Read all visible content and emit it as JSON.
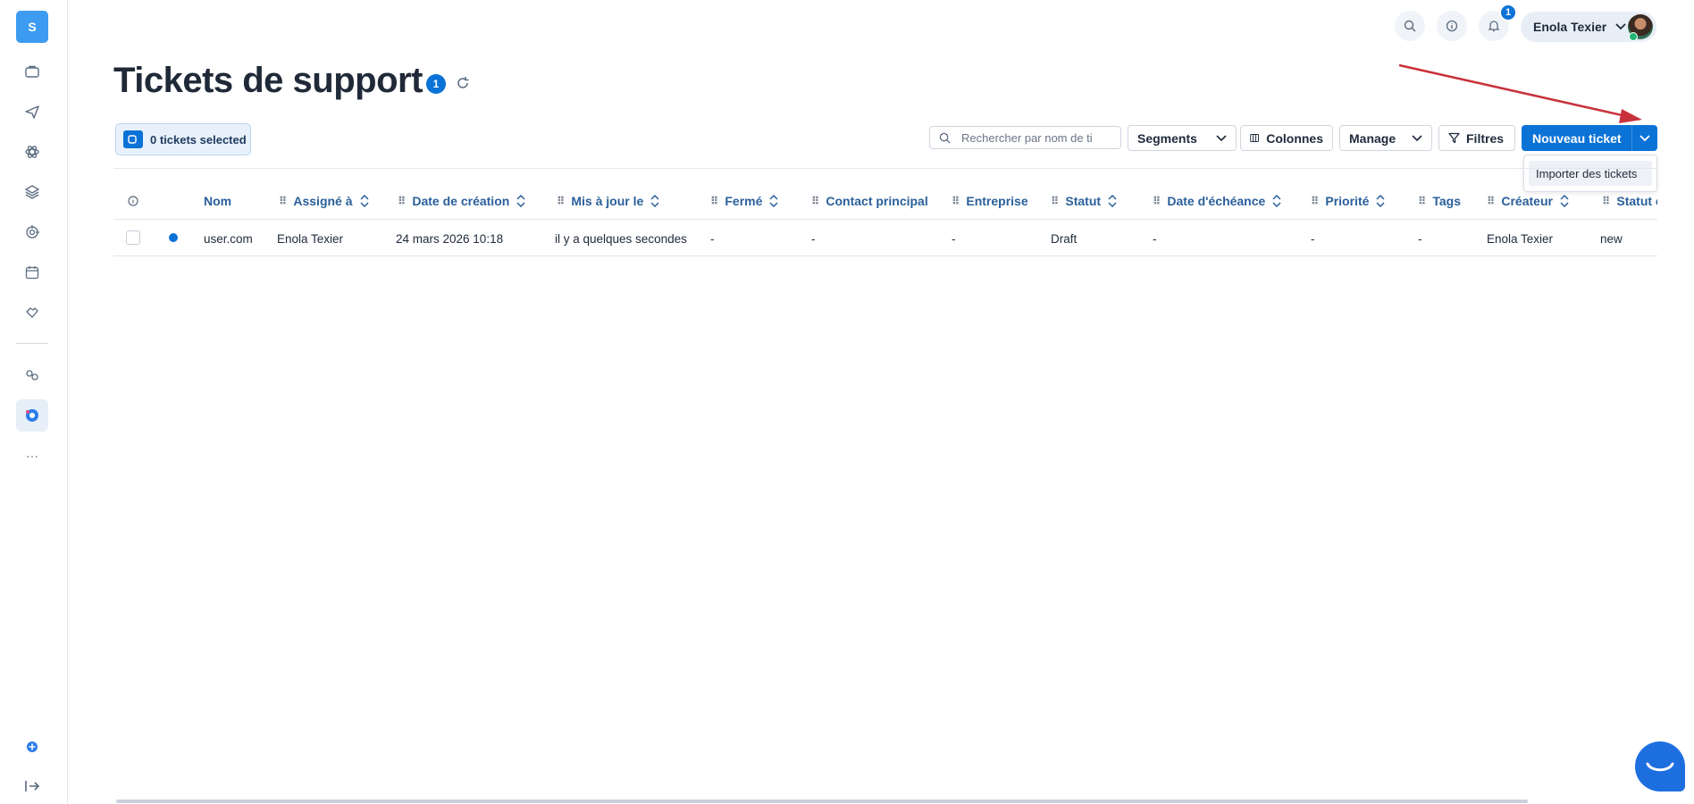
{
  "sidebar": {
    "logo_letter": "S",
    "items": [
      {
        "icon": "briefcase-icon"
      },
      {
        "icon": "paper-plane-icon"
      },
      {
        "icon": "atom-icon"
      },
      {
        "icon": "layers-icon"
      },
      {
        "icon": "target-icon"
      },
      {
        "icon": "calendar-icon"
      },
      {
        "icon": "handshake-icon"
      },
      {
        "icon": "partners-icon"
      },
      {
        "icon": "support-icon",
        "active": true
      },
      {
        "icon": "more-icon",
        "label": "···"
      }
    ],
    "bottom": [
      {
        "icon": "help-icon"
      },
      {
        "icon": "logout-icon"
      }
    ]
  },
  "topbar": {
    "notifications_count": "1",
    "user_name": "Enola Texier"
  },
  "page": {
    "title": "Tickets de support",
    "count": "1"
  },
  "selection": {
    "label": "0 tickets selected"
  },
  "toolbar": {
    "search_placeholder": "Rechercher par nom de ti",
    "segments_label": "Segments",
    "columns_label": "Colonnes",
    "manage_label": "Manage",
    "filters_label": "Filtres",
    "new_ticket_label": "Nouveau ticket",
    "dropdown_items": [
      "Importer des tickets"
    ]
  },
  "table": {
    "columns": [
      "Nom",
      "Assigné à",
      "Date de création",
      "Mis à jour le",
      "Fermé",
      "Contact principal",
      "Entreprise",
      "Statut",
      "Date d'échéance",
      "Priorité",
      "Tags",
      "Créateur",
      "Statut c"
    ],
    "rows": [
      {
        "nom": "user.com",
        "assigne": "Enola Texier",
        "date_creation": "24 mars 2026 10:18",
        "mis_a_jour": "il y a quelques secondes",
        "ferme": "-",
        "contact": "-",
        "entreprise": "-",
        "statut": "Draft",
        "echeance": "-",
        "priorite": "-",
        "tags": "-",
        "createur": "Enola Texier",
        "statut_c": "new"
      }
    ]
  },
  "colors": {
    "primary": "#0b72d6",
    "header_text": "#2a5f9a",
    "arrow": "#c8323b"
  }
}
